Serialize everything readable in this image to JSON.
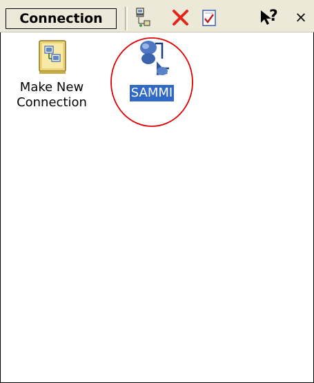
{
  "toolbar": {
    "menu_label": "Connection",
    "help_label": "?",
    "close_label": "×",
    "icons": [
      "network-properties-icon",
      "delete-icon",
      "select-all-icon",
      "help-icon",
      "close-icon"
    ]
  },
  "items": [
    {
      "line1": "Make New",
      "line2": "Connection",
      "icon": "make-new-connection-icon",
      "selected": false
    },
    {
      "line1": "SAMMI",
      "line2": "",
      "icon": "network-connection-icon",
      "selected": true
    }
  ],
  "annotation": {
    "color": "#e00000"
  },
  "colors": {
    "selection": "#316ac5",
    "toolbar": "#ece9d8"
  }
}
